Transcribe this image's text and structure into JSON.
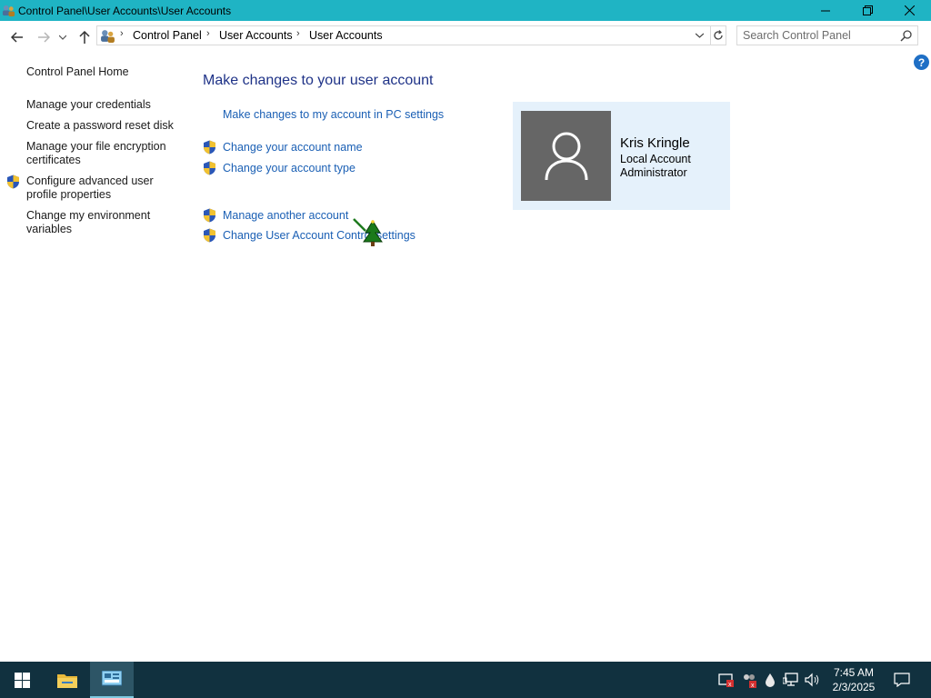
{
  "window": {
    "title": "Control Panel\\User Accounts\\User Accounts",
    "controls": {
      "minimize": "—",
      "maximize": "❐",
      "close": "✕"
    }
  },
  "address_bar": {
    "breadcrumbs": [
      "Control Panel",
      "User Accounts",
      "User Accounts"
    ],
    "separator": "›",
    "search_placeholder": "Search Control Panel"
  },
  "left_pane": {
    "home": "Control Panel Home",
    "links": [
      "Manage your credentials",
      "Create a password reset disk",
      "Manage your file encryption certificates",
      "Configure advanced user profile properties",
      "Change my environment variables"
    ]
  },
  "main": {
    "heading": "Make changes to your user account",
    "tasks": [
      "Make changes to my account in PC settings",
      "Change your account name",
      "Change your account type",
      "Manage another account",
      "Change User Account Control settings"
    ]
  },
  "account": {
    "name": "Kris Kringle",
    "type": "Local Account",
    "role": "Administrator"
  },
  "help_label": "?",
  "taskbar": {
    "time": "7:45 AM",
    "date": "2/3/2025",
    "icons": [
      "windows-start-icon",
      "file-explorer-icon",
      "control-panel-icon"
    ],
    "tray_icons": [
      "security-center-icon",
      "network-people-icon",
      "droplet-icon",
      "network-icon",
      "volume-icon",
      "notification-icon"
    ]
  },
  "colors": {
    "titlebar": "#1fb4c4",
    "heading": "#1e3287",
    "link": "#1a5fb4",
    "card_bg": "#e5f1fb",
    "avatar_bg": "#666666",
    "taskbar": "#11313f"
  }
}
